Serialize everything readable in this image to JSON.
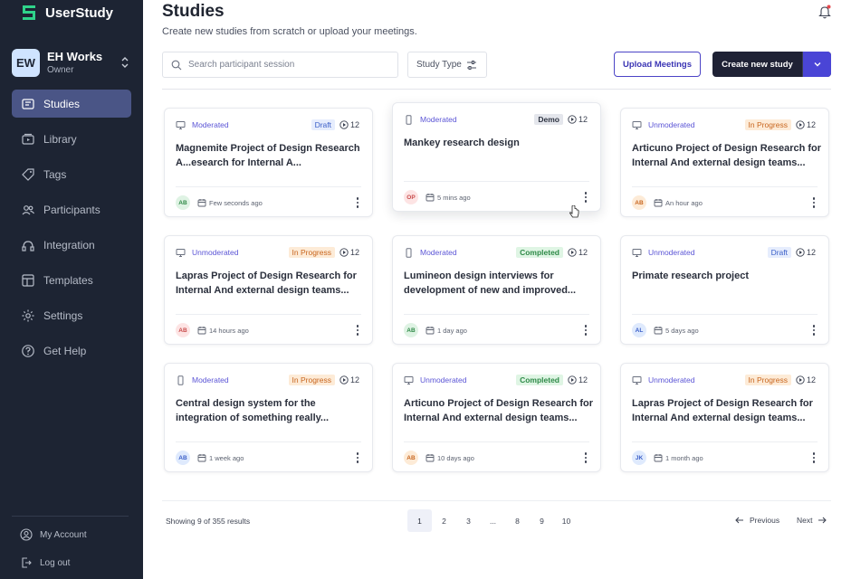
{
  "app": {
    "name": "UserStudy"
  },
  "workspace": {
    "initials": "EW",
    "name": "EH Works",
    "role": "Owner"
  },
  "sidebar": {
    "items": [
      {
        "label": "Studies",
        "icon": "studies-icon",
        "active": true
      },
      {
        "label": "Library",
        "icon": "library-icon",
        "active": false
      },
      {
        "label": "Tags",
        "icon": "tag-icon",
        "active": false
      },
      {
        "label": "Participants",
        "icon": "participants-icon",
        "active": false
      },
      {
        "label": "Integration",
        "icon": "integration-icon",
        "active": false
      },
      {
        "label": "Templates",
        "icon": "templates-icon",
        "active": false
      },
      {
        "label": "Settings",
        "icon": "gear-icon",
        "active": false
      },
      {
        "label": "Get Help",
        "icon": "help-icon",
        "active": false
      }
    ],
    "account_label": "My Account",
    "logout_label": "Log out"
  },
  "header": {
    "title": "Studies",
    "subtitle": "Create new studies from scratch or upload your meetings."
  },
  "toolbar": {
    "search_placeholder": "Search participant session",
    "filter_label": "Study Type",
    "upload_label": "Upload Meetings",
    "create_label": "Create new study"
  },
  "colors": {
    "sidebar_bg": "#1d2433",
    "accent": "#4a45d6",
    "logo_green": "#2fd38a"
  },
  "studies": [
    {
      "type": "Moderated",
      "device": "desktop",
      "badge": "Draft",
      "badge_kind": "draft",
      "count": "12",
      "title": "Magnemite Project of Design Research A...esearch for Internal A...",
      "avatar": "AB",
      "avatar_bg": "#dff3e4",
      "avatar_fg": "#2f8a48",
      "time": "Few seconds ago"
    },
    {
      "type": "Moderated",
      "device": "mobile",
      "badge": "Demo",
      "badge_kind": "demo",
      "count": "12",
      "title": "Mankey research design",
      "avatar": "OP",
      "avatar_bg": "#fde4e4",
      "avatar_fg": "#c84b4b",
      "time": "5 mins ago"
    },
    {
      "type": "Unmoderated",
      "device": "desktop",
      "badge": "In Progress",
      "badge_kind": "inprogress",
      "count": "12",
      "title": "Articuno Project of Design Research  for Internal And external design teams...",
      "avatar": "AB",
      "avatar_bg": "#fdebd7",
      "avatar_fg": "#c8661f",
      "time": "An hour ago"
    },
    {
      "type": "Unmoderated",
      "device": "desktop",
      "badge": "In Progress",
      "badge_kind": "inprogress",
      "count": "12",
      "title": "Lapras Project of Design Research  for Internal And external design teams...",
      "avatar": "AB",
      "avatar_bg": "#fde4e4",
      "avatar_fg": "#c84b4b",
      "time": "14 hours ago"
    },
    {
      "type": "Moderated",
      "device": "mobile",
      "badge": "Completed",
      "badge_kind": "completed",
      "count": "12",
      "title": "Lumineon design interviews for development of  new and improved...",
      "avatar": "AB",
      "avatar_bg": "#dff3e4",
      "avatar_fg": "#2f8a48",
      "time": "1 day ago"
    },
    {
      "type": "Unmoderated",
      "device": "desktop",
      "badge": "Draft",
      "badge_kind": "draft",
      "count": "12",
      "title": "Primate research project",
      "avatar": "AL",
      "avatar_bg": "#dfeafd",
      "avatar_fg": "#3b5fc8",
      "time": "5 days ago"
    },
    {
      "type": "Moderated",
      "device": "mobile",
      "badge": "In Progress",
      "badge_kind": "inprogress",
      "count": "12",
      "title": "Central design system for the integration of something really...",
      "avatar": "AB",
      "avatar_bg": "#dfeafd",
      "avatar_fg": "#3b5fc8",
      "time": "1 week ago"
    },
    {
      "type": "Unmoderated",
      "device": "desktop",
      "badge": "Completed",
      "badge_kind": "completed",
      "count": "12",
      "title": "Articuno Project of Design Research  for Internal And external design teams...",
      "avatar": "AB",
      "avatar_bg": "#fdebd7",
      "avatar_fg": "#c8661f",
      "time": "10 days ago"
    },
    {
      "type": "Unmoderated",
      "device": "desktop",
      "badge": "In Progress",
      "badge_kind": "inprogress",
      "count": "12",
      "title": "Lapras Project of Design Research  for Internal And external design teams...",
      "avatar": "JK",
      "avatar_bg": "#dfeafd",
      "avatar_fg": "#3b5fc8",
      "time": "1 month ago"
    }
  ],
  "pagination": {
    "summary": "Showing 9 of 355 results",
    "pages": [
      "1",
      "2",
      "3",
      "...",
      "8",
      "9",
      "10"
    ],
    "current": "1",
    "prev_label": "Previous",
    "next_label": "Next"
  }
}
